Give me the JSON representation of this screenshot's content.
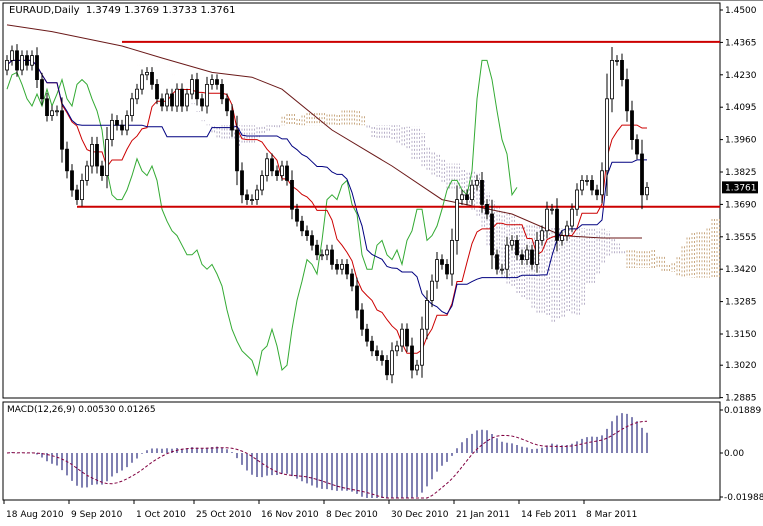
{
  "header": {
    "symbol": "EURAUD,Daily",
    "open": "1.3749",
    "high": "1.3769",
    "low": "1.3733",
    "close": "1.3761"
  },
  "macd_header": {
    "label": "MACD(12,26,9)",
    "main": "0.00530",
    "signal": "0.01265"
  },
  "colors": {
    "bull": "#ffffff",
    "bear": "#000000",
    "tenkan": "#cc0000",
    "kijun": "#000080",
    "chikou": "#33aa33",
    "cloud_a": "#c8a882",
    "cloud_b": "#b8b0c8",
    "ma": "#6b1a1a",
    "level": "#cc0000",
    "hist": "#000066",
    "signal": "#800040"
  },
  "chart_data": [
    {
      "type": "candlestick",
      "title": "EURAUD,Daily",
      "ylim": [
        1.2885,
        1.45
      ],
      "y_ticks": [
        "1.4500",
        "1.4365",
        "1.4230",
        "1.4095",
        "1.3960",
        "1.3825",
        "1.3690",
        "1.3555",
        "1.3420",
        "1.3285",
        "1.3150",
        "1.3020",
        "1.2885"
      ],
      "current_price": "1.3761",
      "x_ticks": [
        {
          "bar": 0,
          "label": "18 Aug 2010"
        },
        {
          "bar": 13,
          "label": "9 Sep 2010"
        },
        {
          "bar": 26,
          "label": "1 Oct 2010"
        },
        {
          "bar": 38,
          "label": "25 Oct 2010"
        },
        {
          "bar": 51,
          "label": "16 Nov 2010"
        },
        {
          "bar": 64,
          "label": "8 Dec 2010"
        },
        {
          "bar": 77,
          "label": "30 Dec 2010"
        },
        {
          "bar": 90,
          "label": "21 Jan 2011"
        },
        {
          "bar": 103,
          "label": "14 Feb 2011"
        },
        {
          "bar": 116,
          "label": "8 Mar 2011"
        }
      ],
      "first_open": 1.425,
      "closes": [
        1.429,
        1.433,
        1.425,
        1.431,
        1.427,
        1.431,
        1.421,
        1.413,
        1.406,
        1.408,
        1.408,
        1.392,
        1.383,
        1.375,
        1.371,
        1.379,
        1.385,
        1.394,
        1.385,
        1.381,
        1.396,
        1.404,
        1.402,
        1.4,
        1.406,
        1.413,
        1.417,
        1.423,
        1.424,
        1.419,
        1.413,
        1.41,
        1.415,
        1.41,
        1.417,
        1.41,
        1.415,
        1.421,
        1.413,
        1.41,
        1.419,
        1.421,
        1.419,
        1.413,
        1.408,
        1.4,
        1.383,
        1.373,
        1.371,
        1.371,
        1.375,
        1.381,
        1.388,
        1.383,
        1.381,
        1.385,
        1.379,
        1.367,
        1.362,
        1.358,
        1.356,
        1.352,
        1.348,
        1.348,
        1.35,
        1.344,
        1.342,
        1.344,
        1.34,
        1.335,
        1.325,
        1.317,
        1.312,
        1.308,
        1.306,
        1.304,
        1.298,
        1.308,
        1.31,
        1.317,
        1.31,
        1.3,
        1.302,
        1.317,
        1.329,
        1.337,
        1.346,
        1.344,
        1.34,
        1.354,
        1.371,
        1.373,
        1.371,
        1.377,
        1.379,
        1.369,
        1.365,
        1.348,
        1.342,
        1.342,
        1.352,
        1.354,
        1.348,
        1.346,
        1.35,
        1.344,
        1.354,
        1.358,
        1.367,
        1.367,
        1.354,
        1.356,
        1.36,
        1.367,
        1.375,
        1.379,
        1.379,
        1.375,
        1.373,
        1.383,
        1.413,
        1.429,
        1.429,
        1.421,
        1.408,
        1.396,
        1.39,
        1.373,
        1.3761
      ],
      "moving_average": [
        [
          0,
          1.4438
        ],
        [
          9,
          1.441
        ],
        [
          23,
          1.435
        ],
        [
          31,
          1.43
        ],
        [
          41,
          1.424
        ],
        [
          49,
          1.422
        ],
        [
          55,
          1.417
        ],
        [
          65,
          1.4
        ],
        [
          77,
          1.385
        ],
        [
          87,
          1.371
        ],
        [
          101,
          1.365
        ],
        [
          111,
          1.356
        ],
        [
          119,
          1.355
        ],
        [
          127,
          1.355
        ]
      ],
      "levels": [
        {
          "price": 1.4367,
          "from_bar": 23
        },
        {
          "price": 1.368,
          "from_bar": 14
        }
      ],
      "indicators": [
        "Ichimoku(9,26,52)",
        "Moving Average"
      ]
    },
    {
      "type": "bar",
      "title": "MACD(12,26,9)",
      "ylim": [
        -0.01988,
        0.01889
      ],
      "y_ticks": [
        "0.01889",
        "0.00",
        "-0.01988"
      ]
    }
  ]
}
